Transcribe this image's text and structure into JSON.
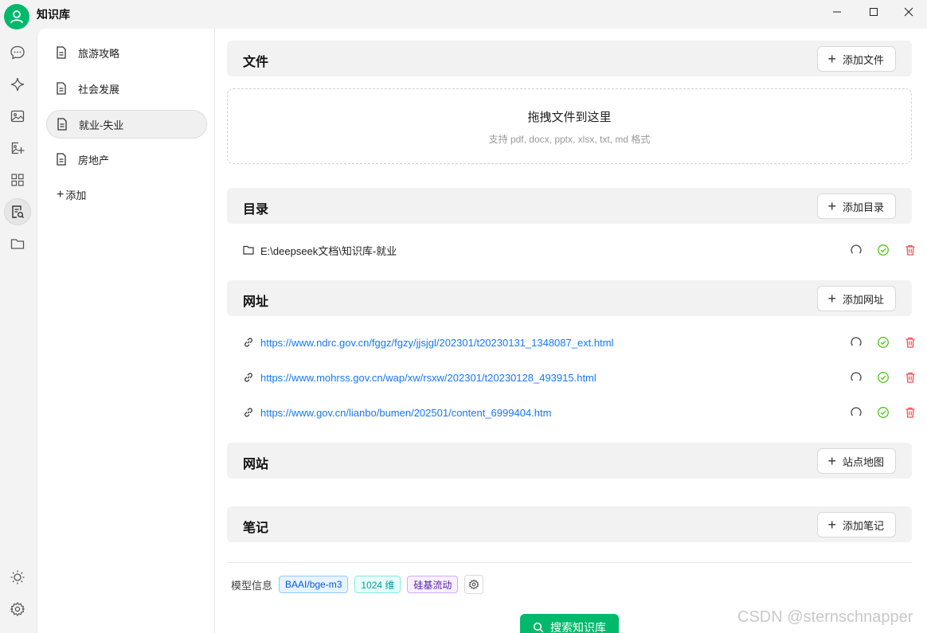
{
  "window": {
    "title": "知识库"
  },
  "rail": {
    "items": [
      "chat-icon",
      "sparkle-icon",
      "image-icon",
      "image-edit-icon",
      "apps-icon",
      "knowledge-base-icon",
      "folder-icon"
    ],
    "bottom": [
      "theme-icon",
      "settings-icon"
    ]
  },
  "kb_list": {
    "items": [
      {
        "label": "旅游攻略"
      },
      {
        "label": "社会发展"
      },
      {
        "label": "就业-失业"
      },
      {
        "label": "房地产"
      }
    ],
    "active_index": 2,
    "add_label": "添加"
  },
  "sections": {
    "files": {
      "title": "文件",
      "button": "添加文件"
    },
    "dropzone": {
      "title": "拖拽文件到这里",
      "subtitle": "支持 pdf, docx, pptx, xlsx, txt, md 格式"
    },
    "directories": {
      "title": "目录",
      "button": "添加目录",
      "items": [
        {
          "path": "E:\\deepseek文档\\知识库-就业"
        }
      ]
    },
    "urls": {
      "title": "网址",
      "button": "添加网址",
      "items": [
        {
          "url": "https://www.ndrc.gov.cn/fggz/fgzy/jjsjgl/202301/t20230131_1348087_ext.html"
        },
        {
          "url": "https://www.mohrss.gov.cn/wap/xw/rsxw/202301/t20230128_493915.html"
        },
        {
          "url": "https://www.gov.cn/lianbo/bumen/202501/content_6999404.htm"
        }
      ]
    },
    "websites": {
      "title": "网站",
      "button": "站点地图"
    },
    "notes": {
      "title": "笔记",
      "button": "添加笔记"
    }
  },
  "model_info": {
    "label": "模型信息",
    "model": "BAAI/bge-m3",
    "dims": "1024 维",
    "provider": "硅基流动"
  },
  "search_button": "搜索知识库",
  "watermark": "CSDN @sternschnapper",
  "colors": {
    "accent": "#00b96b",
    "link": "#1677ff",
    "ok": "#52c41a",
    "danger": "#ff4d4f"
  }
}
